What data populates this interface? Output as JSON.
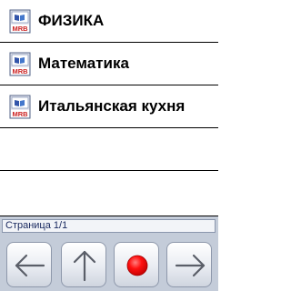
{
  "list": {
    "items": [
      {
        "label": "ФИЗИКА",
        "icon": "mrb-book-icon"
      },
      {
        "label": "Математика",
        "icon": "mrb-book-icon"
      },
      {
        "label": "Итальянская кухня",
        "icon": "mrb-book-icon"
      },
      {
        "label": ""
      },
      {
        "label": ""
      }
    ],
    "icon_text": "MRB"
  },
  "status": {
    "page": "Страница 1/1"
  },
  "toolbar": {
    "buttons": [
      {
        "icon": "arrow-left-icon"
      },
      {
        "icon": "arrow-up-icon"
      },
      {
        "icon": "record-icon",
        "color": "#ff0000"
      },
      {
        "icon": "arrow-right-icon"
      }
    ]
  },
  "colors": {
    "panel": "#c4ccd9",
    "icon_red": "#cc2222",
    "record_red": "#ff0000"
  }
}
